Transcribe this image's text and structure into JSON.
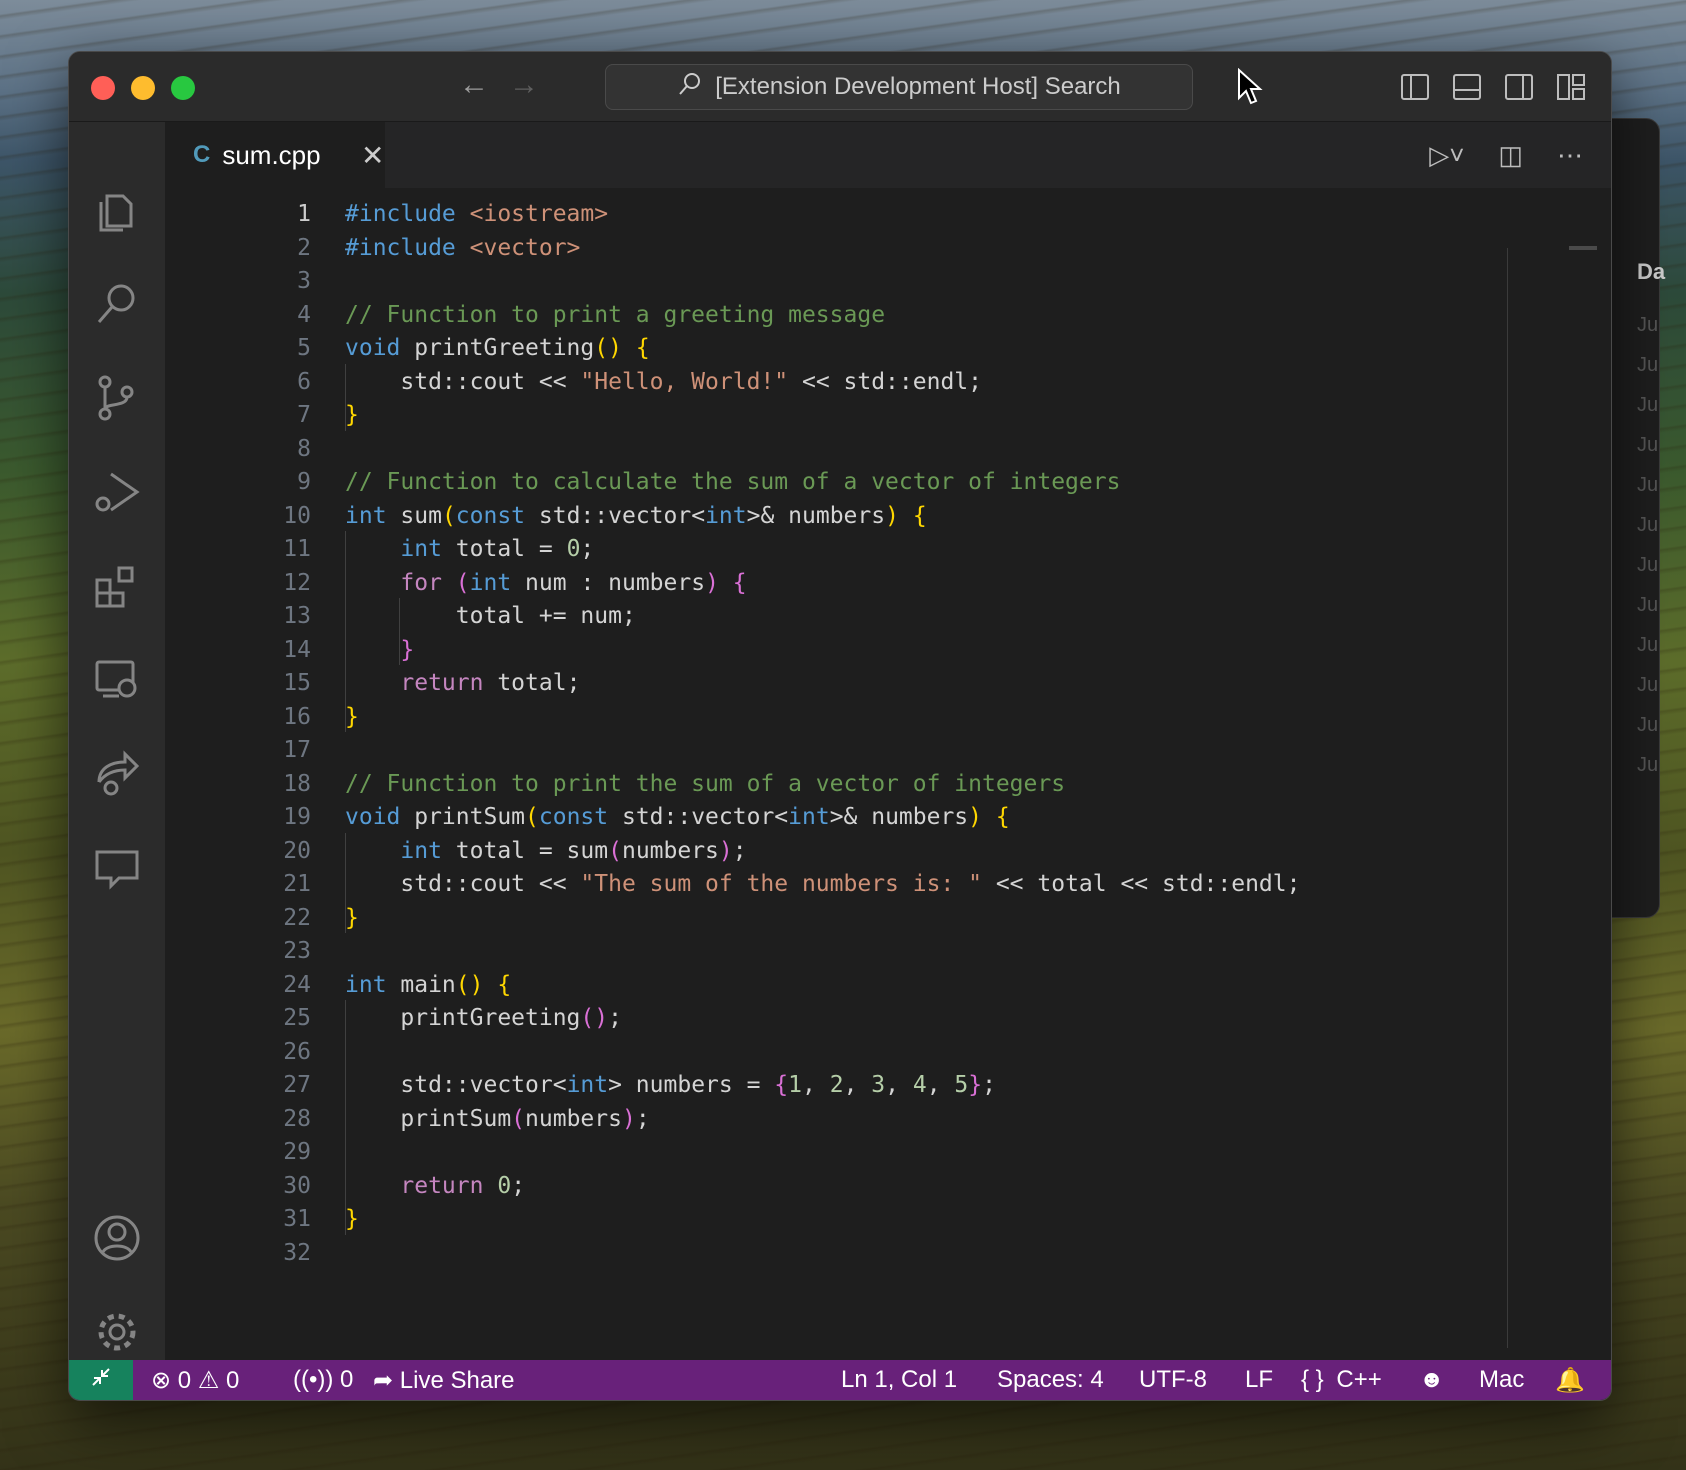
{
  "window": {
    "search_text": "[Extension Development Host] Search"
  },
  "tab": {
    "filename": "sum.cpp",
    "icon": "C"
  },
  "background_window": {
    "header": "Da",
    "rows": [
      "Ju",
      "Ju",
      "Ju",
      "Ju",
      "Ju",
      "Ju",
      "Ju",
      "Ju",
      "Ju",
      "Ju",
      "Ju",
      "Ju"
    ]
  },
  "editor": {
    "active_line": 1,
    "lines": [
      "#include <iostream>",
      "#include <vector>",
      "",
      "// Function to print a greeting message",
      "void printGreeting() {",
      "    std::cout << \"Hello, World!\" << std::endl;",
      "}",
      "",
      "// Function to calculate the sum of a vector of integers",
      "int sum(const std::vector<int>& numbers) {",
      "    int total = 0;",
      "    for (int num : numbers) {",
      "        total += num;",
      "    }",
      "    return total;",
      "}",
      "",
      "// Function to print the sum of a vector of integers",
      "void printSum(const std::vector<int>& numbers) {",
      "    int total = sum(numbers);",
      "    std::cout << \"The sum of the numbers is: \" << total << std::endl;",
      "}",
      "",
      "int main() {",
      "    printGreeting();",
      "",
      "    std::vector<int> numbers = {1, 2, 3, 4, 5};",
      "    printSum(numbers);",
      "",
      "    return 0;",
      "}",
      ""
    ]
  },
  "statusbar": {
    "errors": "0",
    "warnings": "0",
    "ports": "0",
    "live_share": "Live Share",
    "cursor": "Ln 1, Col 1",
    "spaces": "Spaces: 4",
    "encoding": "UTF-8",
    "eol": "LF",
    "language_icon": "{ }",
    "language": "C++",
    "profile": "Mac"
  },
  "colors": {
    "statusbar": "#68217a",
    "remote": "#16825d",
    "editor_bg": "#1e1e1e"
  }
}
